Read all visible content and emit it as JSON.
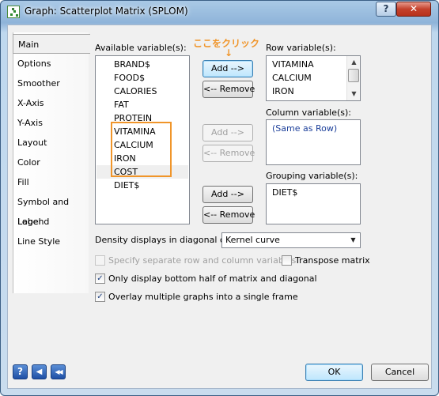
{
  "window": {
    "title": "Graph: Scatterplot Matrix (SPLOM)",
    "help_glyph": "?",
    "close_glyph": "✕"
  },
  "tabs": [
    {
      "label": "Main",
      "selected": true
    },
    {
      "label": "Options"
    },
    {
      "label": "Smoother"
    },
    {
      "label": "X-Axis"
    },
    {
      "label": "Y-Axis"
    },
    {
      "label": "Layout"
    },
    {
      "label": "Color"
    },
    {
      "label": "Fill"
    },
    {
      "label": "Symbol and Label"
    },
    {
      "label": "Legend"
    },
    {
      "label": "Line Style"
    }
  ],
  "available": {
    "label": "Available variable(s):",
    "items": [
      "BRAND$",
      "FOOD$",
      "CALORIES",
      "FAT",
      "PROTEIN",
      "VITAMINA",
      "CALCIUM",
      "IRON",
      "COST",
      "DIET$"
    ]
  },
  "annotation": {
    "text": "ここをクリック",
    "arrow": "↓",
    "color": "#f0952a"
  },
  "row_vars": {
    "label": "Row variable(s):",
    "items": [
      "VITAMINA",
      "CALCIUM",
      "IRON"
    ],
    "add_label": "Add -->",
    "remove_label": "<-- Remove"
  },
  "col_vars": {
    "label": "Column variable(s):",
    "items": [
      "(Same as Row)"
    ],
    "add_label": "Add -->",
    "remove_label": "<-- Remove"
  },
  "group_vars": {
    "label": "Grouping variable(s):",
    "items": [
      "DIET$"
    ],
    "add_label": "Add -->",
    "remove_label": "<-- Remove"
  },
  "density": {
    "label": "Density displays in diagonal cells:",
    "value": "Kernel curve"
  },
  "checkboxes": {
    "separate": {
      "label": "Specify separate row and column variables",
      "checked": false,
      "disabled": true
    },
    "transpose": {
      "label": "Transpose matrix",
      "checked": false
    },
    "bottom_half": {
      "label": "Only display bottom half of matrix and diagonal",
      "checked": true
    },
    "overlay": {
      "label": "Overlay multiple graphs into a single frame",
      "checked": true
    }
  },
  "footer": {
    "help_glyph": "?",
    "back_glyph": "◀",
    "rewind_glyph": "◀◀",
    "ok_label": "OK",
    "cancel_label": "Cancel"
  },
  "colors": {
    "accent_orange": "#f0952a",
    "column_text": "#1c3f9a"
  }
}
